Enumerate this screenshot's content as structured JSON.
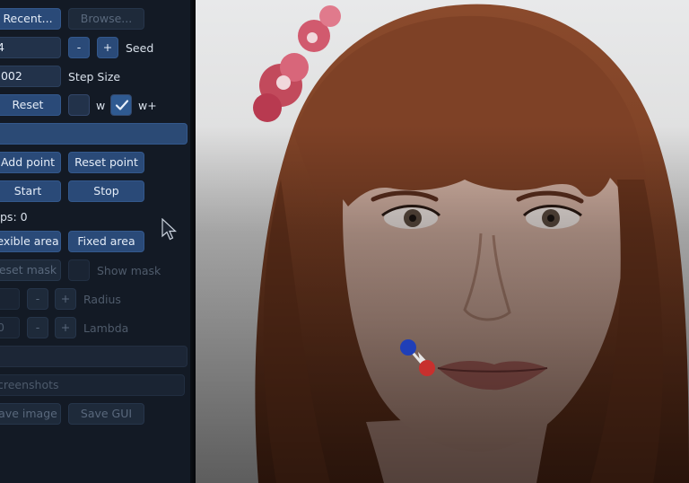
{
  "panel": {
    "recent_label": "Recent...",
    "browse_label": "Browse...",
    "seed_value": "4",
    "minus_label": "-",
    "plus_label": "+",
    "seed_label": "Seed",
    "step_value": ".002",
    "step_label": "Step Size",
    "reset_label": "Reset",
    "w_label": "w",
    "wplus_label": "w+",
    "add_point_label": "Add point",
    "reset_point_label": "Reset point",
    "start_label": "Start",
    "stop_label": "Stop",
    "steps_label": "ps: 0",
    "flexible_area_label": "exible area",
    "fixed_area_label": "Fixed area",
    "reset_mask_label": "eset mask",
    "show_mask_label": "Show mask",
    "radius_value": "",
    "radius_minus": "-",
    "radius_plus": "+",
    "radius_label": "Radius",
    "lambda_value": "0",
    "lambda_minus": "-",
    "lambda_plus": "+",
    "lambda_label": "Lambda",
    "screenshots_label": "creenshots",
    "save_image_label": "ave image",
    "save_gui_label": "Save GUI"
  },
  "colors": {
    "handle_point": "#1f3fb8",
    "target_point": "#c8302e",
    "accent": "#2a4a78"
  }
}
